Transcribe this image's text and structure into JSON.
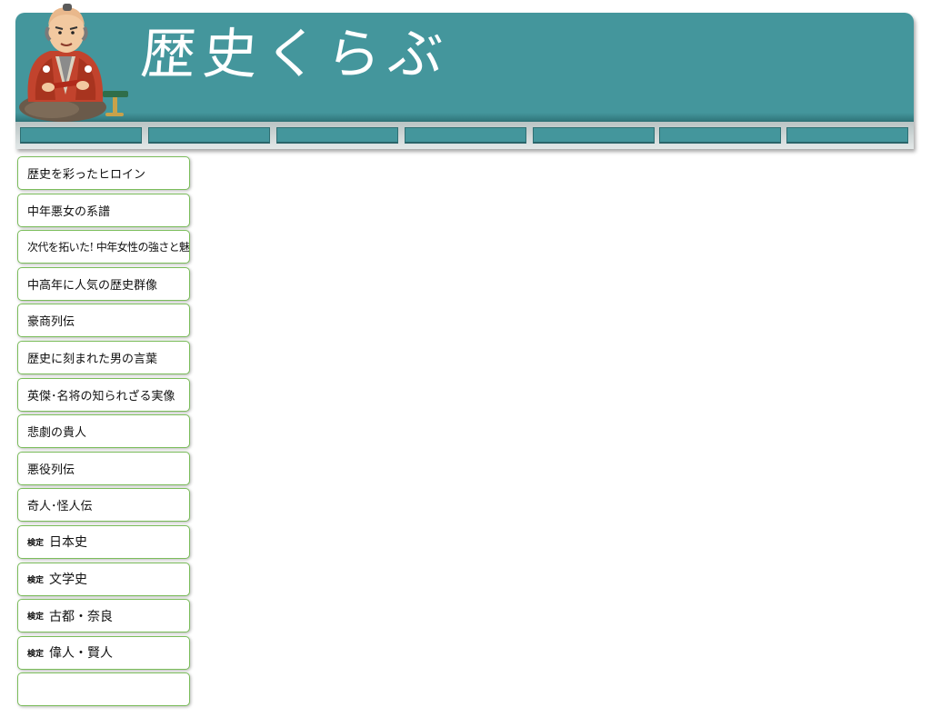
{
  "header": {
    "site_title": "歴史くらぶ",
    "brand_color": "#44969c",
    "nav_tabs": [
      "",
      "",
      "",
      "",
      "",
      "",
      ""
    ]
  },
  "sidemenu": {
    "border_color": "#7bbd5b",
    "items": [
      {
        "label": "歴史を彩ったヒロイン"
      },
      {
        "label": "中年悪女の系譜"
      },
      {
        "label": "次代を拓いた! 中年女性の強さと魅力"
      },
      {
        "label": "中高年に人気の歴史群像"
      },
      {
        "label": "豪商列伝"
      },
      {
        "label": "歴史に刻まれた男の言葉"
      },
      {
        "label": "英傑･名将の知られざる実像"
      },
      {
        "label": "悲劇の貴人"
      },
      {
        "label": "悪役列伝"
      },
      {
        "label": "奇人･怪人伝"
      },
      {
        "prefix": "検定",
        "label": "日本史"
      },
      {
        "prefix": "検定",
        "label": "文学史"
      },
      {
        "prefix": "検定",
        "label": "古都・奈良"
      },
      {
        "prefix": "検定",
        "label": "偉人・賢人"
      },
      {
        "label": ""
      }
    ]
  }
}
